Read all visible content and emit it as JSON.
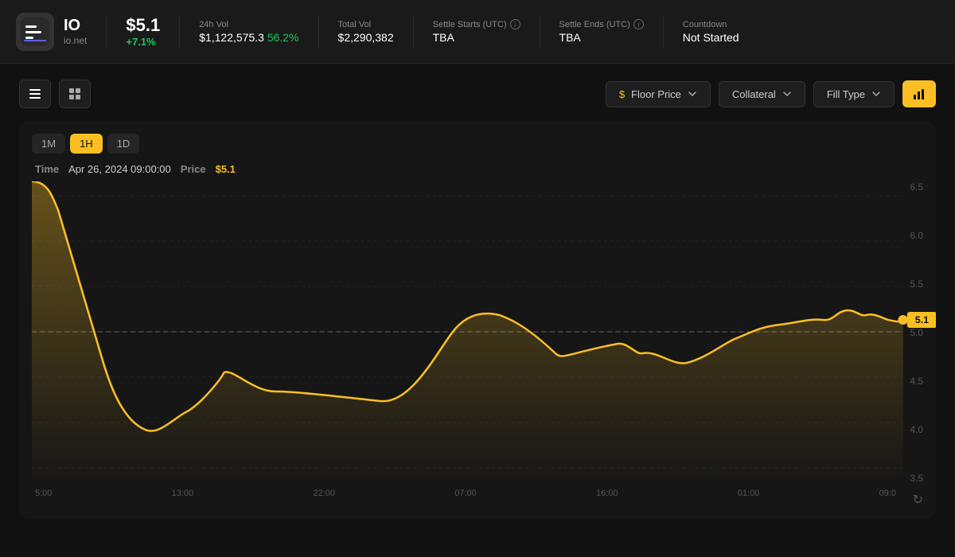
{
  "header": {
    "logo_alt": "IO",
    "ticker": "IO",
    "subtitle": "io.net",
    "price": "$5.1",
    "price_change": "+7.1%",
    "stats": [
      {
        "label": "24h Vol",
        "value": "$1,122,575.3",
        "extra": "56.2%",
        "has_info": false
      },
      {
        "label": "Total Vol",
        "value": "$2,290,382",
        "has_info": false
      },
      {
        "label": "Settle Starts (UTC)",
        "value": "TBA",
        "has_info": true
      },
      {
        "label": "Settle Ends (UTC)",
        "value": "TBA",
        "has_info": true
      },
      {
        "label": "Countdown",
        "value": "Not Started",
        "has_info": false
      }
    ]
  },
  "toolbar": {
    "view_list_label": "list",
    "view_grid_label": "grid",
    "floor_price_label": "Floor Price",
    "collateral_label": "Collateral",
    "fill_type_label": "Fill Type",
    "chart_icon_label": "chart"
  },
  "chart": {
    "time_buttons": [
      "1M",
      "1H",
      "1D"
    ],
    "active_time": "1H",
    "tooltip_time_label": "Time",
    "tooltip_time_value": "Apr 26, 2024 09:00:00",
    "tooltip_price_label": "Price",
    "tooltip_price_value": "$5.1",
    "current_price": "5.1",
    "y_labels": [
      "6.5",
      "6.0",
      "5.5",
      "5.0",
      "4.5",
      "4.0",
      "3.5"
    ],
    "x_labels": [
      "5:00",
      "13:00",
      "22:00",
      "07:00",
      "16:00",
      "01:00",
      "09:0"
    ]
  }
}
